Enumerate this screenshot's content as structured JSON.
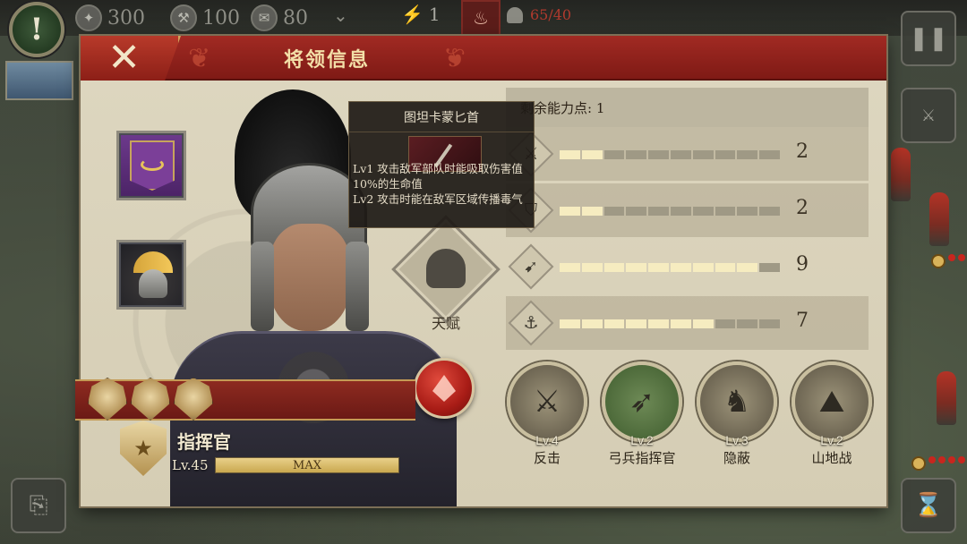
{
  "hud": {
    "resource_1": "300",
    "resource_2": "100",
    "resource_3": "80",
    "counter": "1",
    "troops": "65/40"
  },
  "panel": {
    "title": "将领信息",
    "close_icon": "close-x-icon"
  },
  "equipment": [
    {
      "name": "banner",
      "icon": "purple-banner-icon"
    },
    {
      "name": "helmet",
      "icon": "golden-crest-helmet-icon"
    }
  ],
  "talent": {
    "label": "天赋",
    "icon": "legion-helmet-icon"
  },
  "tooltip": {
    "title": "图坦卡蒙匕首",
    "line1": "Lv1  攻击敌军部队时能吸取伤害值",
    "line2": "10%的生命值",
    "line3": "Lv2  攻击时能在敌军区域传播毒气"
  },
  "stats": {
    "header": "剩余能力点: 1",
    "max": 10,
    "rows": [
      {
        "icon": "sword-icon",
        "value": 2
      },
      {
        "icon": "shield-icon",
        "value": 2
      },
      {
        "icon": "bow-icon",
        "value": 9
      },
      {
        "icon": "anchor-icon",
        "value": 7
      }
    ]
  },
  "commander": {
    "rank_medals": 3,
    "title": "指挥官",
    "level": "Lv.45",
    "xp_label": "MAX",
    "xp_fraction": 1.0
  },
  "skills": [
    {
      "level": "Lv.4",
      "name": "反击",
      "icon": "counterattack-icon"
    },
    {
      "level": "Lv.2",
      "name": "弓兵指挥官",
      "icon": "archer-commander-icon"
    },
    {
      "level": "Lv.3",
      "name": "隐蔽",
      "icon": "concealment-icon"
    },
    {
      "level": "Lv.2",
      "name": "山地战",
      "icon": "mountain-warfare-icon"
    }
  ],
  "colors": {
    "header_red": "#8c1f17",
    "panel_beige": "#d9d2bb",
    "bar_on": "#f6ecc0",
    "bar_off": "#9f9985"
  }
}
